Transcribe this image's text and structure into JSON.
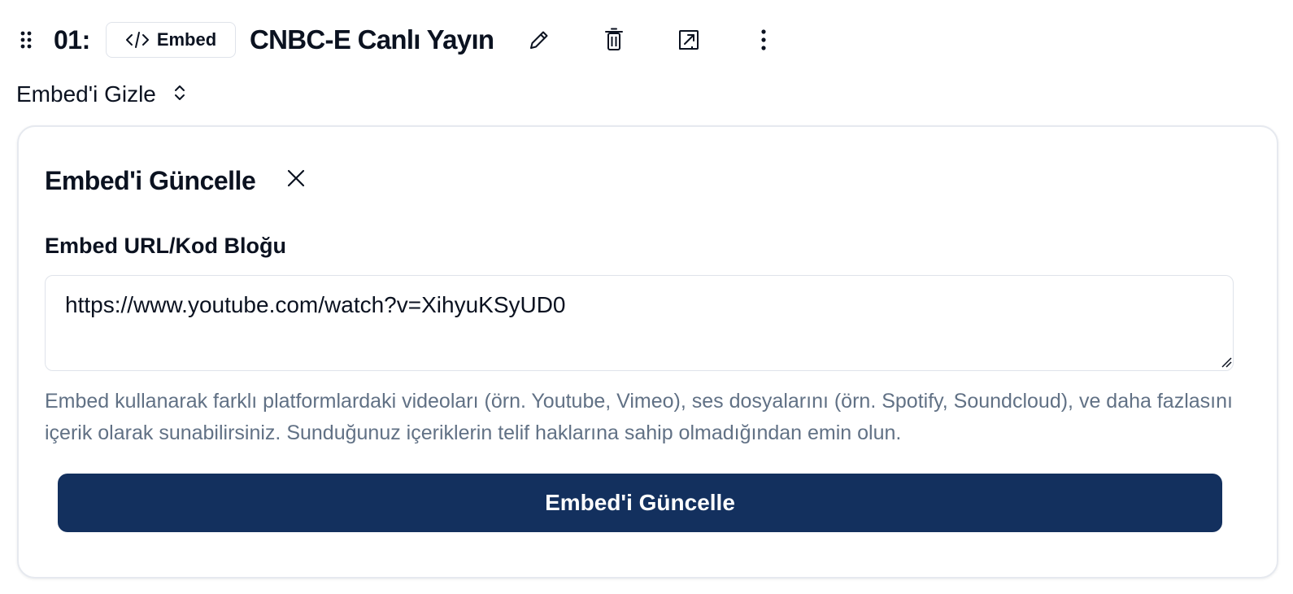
{
  "item": {
    "index": "01:",
    "type_badge": "Embed",
    "title": "CNBC-E Canlı Yayın"
  },
  "toggle": {
    "label": "Embed'i Gizle"
  },
  "card": {
    "title": "Embed'i Güncelle",
    "field_label": "Embed URL/Kod Bloğu",
    "field_value": "https://www.youtube.com/watch?v=XihyuKSyUD0",
    "help_text": "Embed kullanarak farklı platformlardaki videoları (örn. Youtube, Vimeo), ses dosyalarını (örn. Spotify, Soundcloud), ve daha fazlasını içerik olarak sunabilirsiniz. Sunduğunuz içeriklerin telif haklarına sahip olmadığından emin olun.",
    "submit_label": "Embed'i Güncelle"
  },
  "icons": {
    "drag": "drag-handle-icon",
    "code": "code-icon",
    "edit": "pencil-icon",
    "delete": "trash-icon",
    "open": "external-link-icon",
    "more": "more-vertical-icon",
    "toggle": "chevron-up-down-icon",
    "close": "close-icon"
  },
  "colors": {
    "primary_button": "#13305e",
    "help_text": "#617185",
    "border": "#dfe3ea"
  }
}
